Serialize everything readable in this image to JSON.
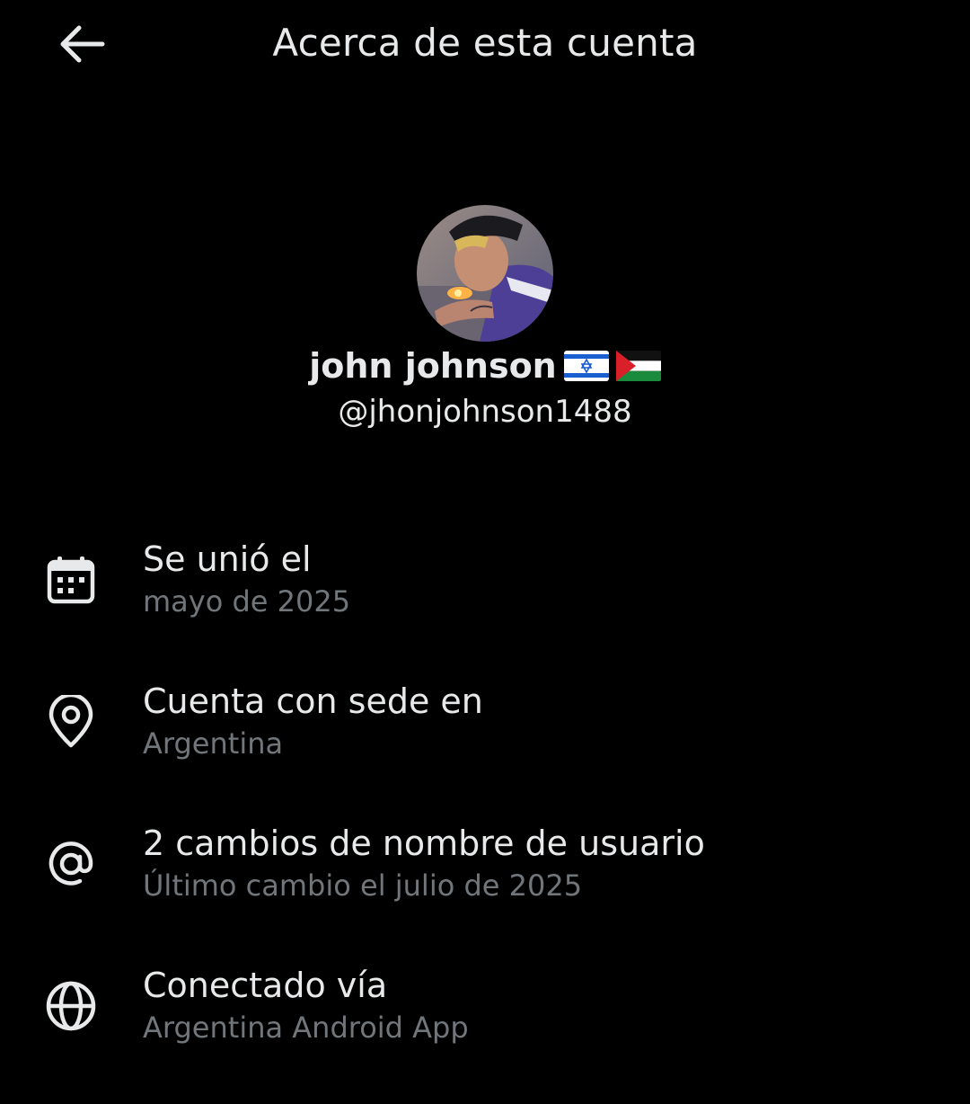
{
  "header": {
    "title": "Acerca de esta cuenta",
    "back_icon": "arrow-left-icon"
  },
  "profile": {
    "display_name": "john johnson",
    "flags": [
      "israel-flag",
      "palestine-flag"
    ],
    "handle": "@jhonjohnson1488"
  },
  "info": {
    "joined": {
      "icon": "calendar-icon",
      "title": "Se unió el",
      "value": "mayo de 2025"
    },
    "location": {
      "icon": "location-pin-icon",
      "title": "Cuenta con sede en",
      "value": "Argentina"
    },
    "username_changes": {
      "icon": "at-sign-icon",
      "title": "2 cambios de nombre de usuario",
      "value": "Último cambio el julio de 2025"
    },
    "connected": {
      "icon": "globe-icon",
      "title": "Conectado vía",
      "value": "Argentina Android App"
    }
  },
  "colors": {
    "background": "#000000",
    "primary_text": "#e7e9ea",
    "secondary_text": "#71767b"
  }
}
